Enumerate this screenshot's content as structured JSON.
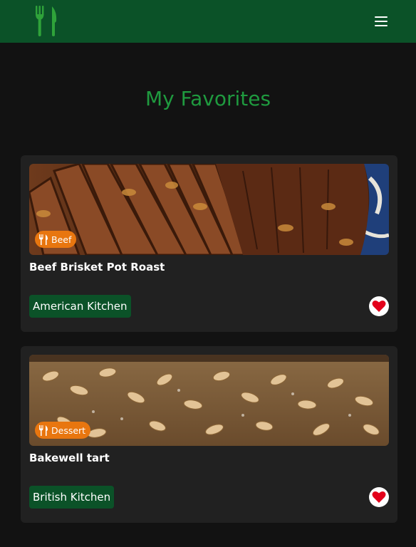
{
  "navbar": {
    "logo_icon": "fork-knife-icon",
    "menu_icon": "hamburger-menu-icon",
    "brand_color": "#0b5228"
  },
  "page": {
    "title": "My Favorites",
    "title_color": "#1f9a3f"
  },
  "recipes": [
    {
      "category": "Beef",
      "category_icon": "utensils-icon",
      "title": "Beef Brisket Pot Roast",
      "kitchen": "American Kitchen",
      "favorite": true,
      "image": "sliced beef brisket"
    },
    {
      "category": "Dessert",
      "category_icon": "utensils-icon",
      "title": "Bakewell tart",
      "kitchen": "British Kitchen",
      "favorite": true,
      "image": "almond topped tart"
    }
  ],
  "colors": {
    "badge": "#e8760f",
    "card": "#212121",
    "background": "#121212",
    "heart": "#e3001b"
  }
}
